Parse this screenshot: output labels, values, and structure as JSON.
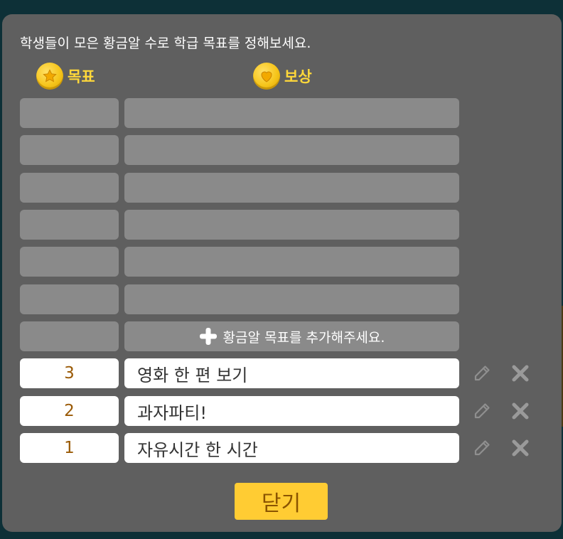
{
  "modal": {
    "instruction": "학생들이 모은 황금알 수로 학급 목표를 정해보세요.",
    "goal_header": "목표",
    "reward_header": "보상",
    "add_goal_label": "황금알 목표를 추가해주세요.",
    "goals": [
      {
        "count": "3",
        "reward": "영화 한 편 보기"
      },
      {
        "count": "2",
        "reward": "과자파티!"
      },
      {
        "count": "1",
        "reward": "자유시간 한 시간"
      }
    ],
    "close_label": "닫기"
  },
  "icons": {
    "goal": "star-coin-icon",
    "reward": "heart-coin-icon",
    "add": "plus-icon",
    "edit": "pencil-icon",
    "delete": "x-icon"
  },
  "colors": {
    "backdrop": "#0d3037",
    "modal": "#5f5f5f",
    "empty_slot": "#8a8a8a",
    "header_accent": "#ffd83a",
    "close_button": "#ffcc33",
    "count_text": "#9a5a06"
  }
}
